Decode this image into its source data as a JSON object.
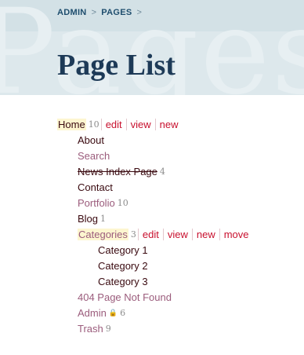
{
  "header": {
    "watermark": "Pages",
    "breadcrumb": [
      "ADMIN",
      "PAGES"
    ],
    "separator": ">",
    "title": "Page List"
  },
  "tree": [
    {
      "label": "Home",
      "count": "10",
      "level": 0,
      "style": "dark",
      "highlight": true,
      "actions": [
        "edit",
        "view",
        "new"
      ]
    },
    {
      "label": "About",
      "level": 1,
      "style": "dark"
    },
    {
      "label": "Search",
      "level": 1,
      "style": "light"
    },
    {
      "label": "News Index Page",
      "count": "4",
      "level": 1,
      "style": "struck"
    },
    {
      "label": "Contact",
      "level": 1,
      "style": "dark"
    },
    {
      "label": "Portfolio",
      "count": "10",
      "level": 1,
      "style": "light"
    },
    {
      "label": "Blog",
      "count": "1",
      "level": 1,
      "style": "dark"
    },
    {
      "label": "Categories",
      "count": "3",
      "level": 1,
      "style": "light",
      "highlight": true,
      "actions": [
        "edit",
        "view",
        "new",
        "move"
      ]
    },
    {
      "label": "Category 1",
      "level": 2,
      "style": "dark"
    },
    {
      "label": "Category 2",
      "level": 2,
      "style": "dark"
    },
    {
      "label": "Category 3",
      "level": 2,
      "style": "dark"
    },
    {
      "label": "404 Page Not Found",
      "level": 1,
      "style": "light"
    },
    {
      "label": "Admin",
      "count": "6",
      "level": 1,
      "style": "light",
      "locked": true
    },
    {
      "label": "Trash",
      "count": "9",
      "level": 1,
      "style": "light"
    }
  ],
  "colors": {
    "header_bg": "#dde8ec",
    "title": "#1d3a57",
    "action_link": "#c8102e",
    "highlight": "#fdf6d0"
  }
}
